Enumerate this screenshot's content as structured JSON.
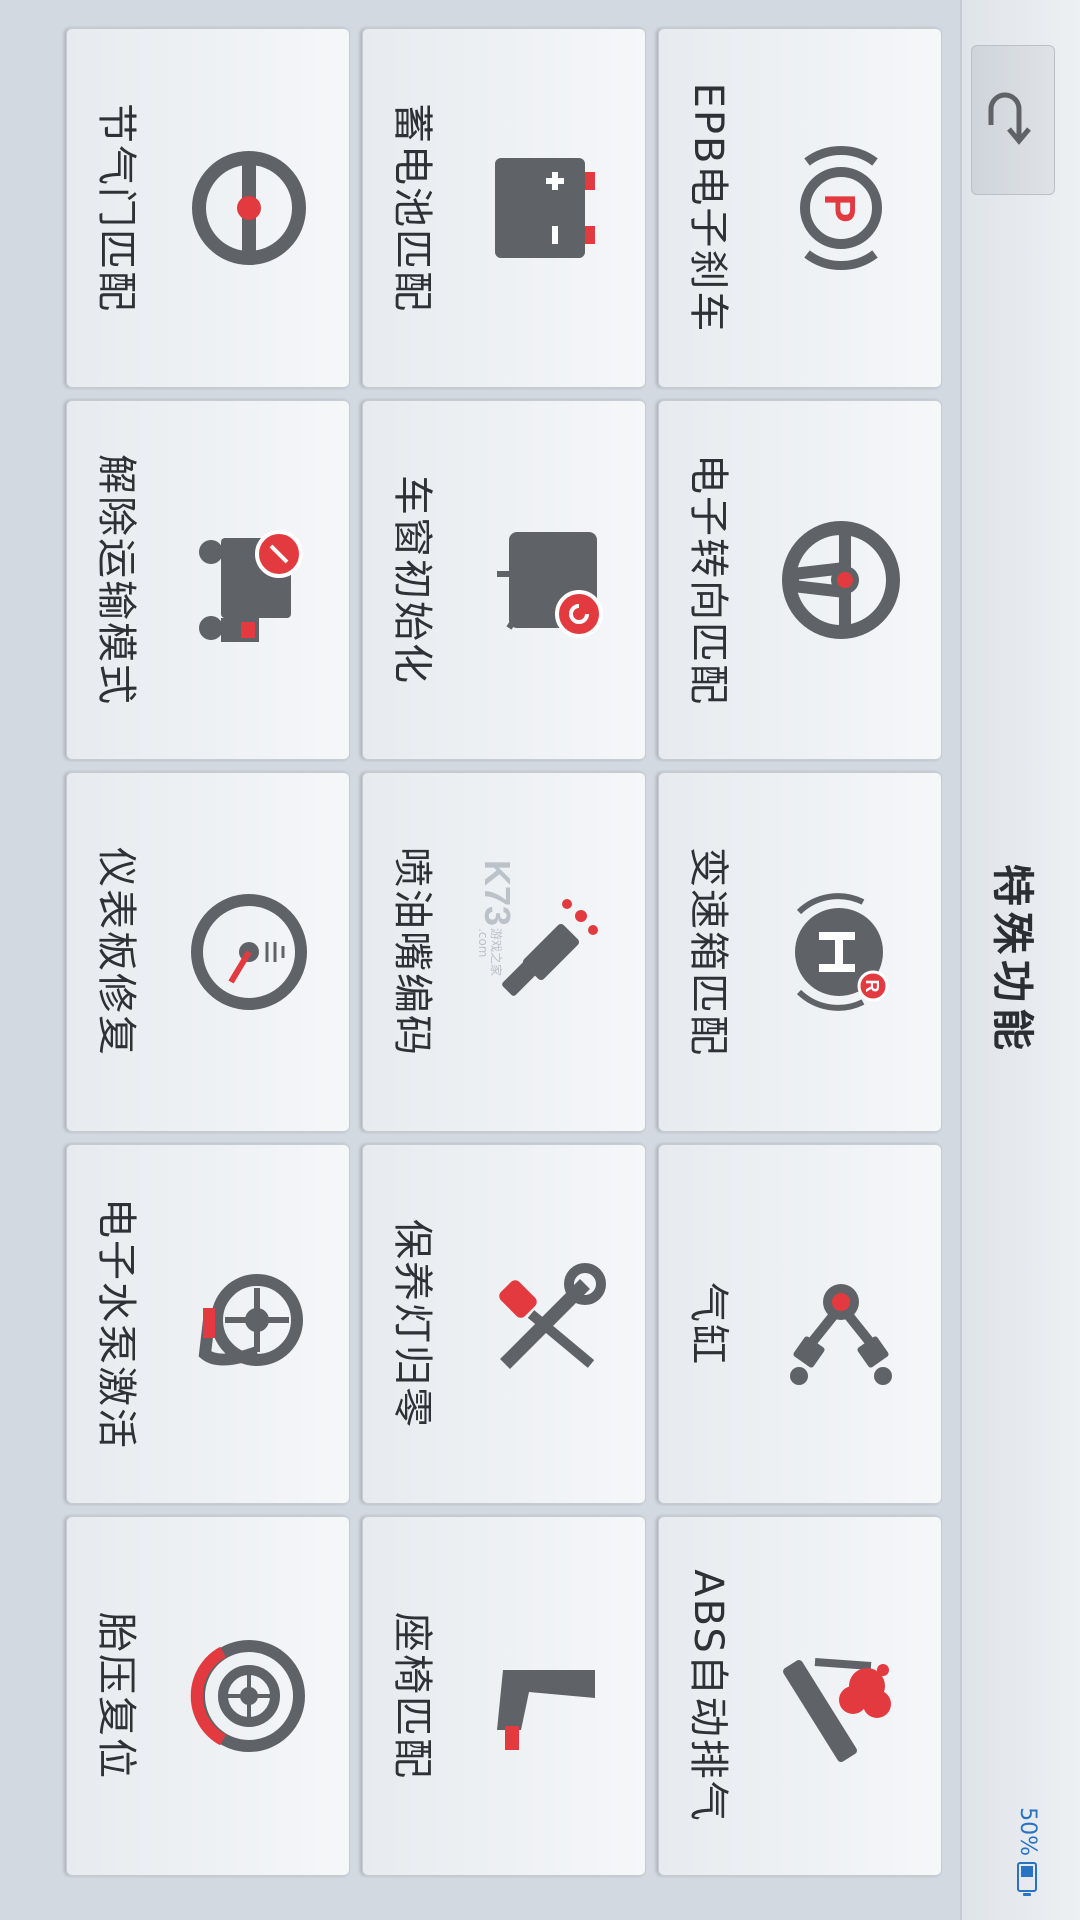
{
  "header": {
    "title": "特殊功能",
    "battery_percent": "50%",
    "battery_level": 0.5
  },
  "tiles": [
    {
      "label": "EPB电子刹车",
      "icon": "parking-brake-icon"
    },
    {
      "label": "电子转向匹配",
      "icon": "steering-wheel-icon"
    },
    {
      "label": "变速箱匹配",
      "icon": "gearbox-icon"
    },
    {
      "label": "气缸",
      "icon": "cylinder-icon"
    },
    {
      "label": "ABS自动排气",
      "icon": "abs-bleed-icon"
    },
    {
      "label": "蓄电池匹配",
      "icon": "battery-icon"
    },
    {
      "label": "车窗初始化",
      "icon": "car-window-icon"
    },
    {
      "label": "喷油嘴编码",
      "icon": "injector-icon"
    },
    {
      "label": "保养灯归零",
      "icon": "maintenance-tools-icon"
    },
    {
      "label": "座椅匹配",
      "icon": "seat-icon"
    },
    {
      "label": "节气门匹配",
      "icon": "throttle-icon"
    },
    {
      "label": "解除运输模式",
      "icon": "transport-mode-icon"
    },
    {
      "label": "仪表板修复",
      "icon": "dashboard-gauge-icon"
    },
    {
      "label": "电子水泵激活",
      "icon": "water-pump-icon"
    },
    {
      "label": "胎压复位",
      "icon": "tire-pressure-icon"
    }
  ],
  "colors": {
    "accent_red": "#e23a3f",
    "icon_gray": "#5f6368",
    "battery_blue": "#2a72c4"
  },
  "watermark": {
    "brand": "K73",
    "subtitle": "游戏之家",
    "domain": ".com"
  }
}
